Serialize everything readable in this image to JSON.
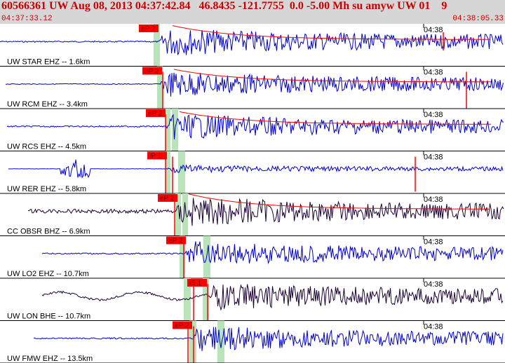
{
  "header": {
    "title": "60566361 UW Aug 08, 2013 04:37:42.84   46.8435 -121.7755  0.0 -5.00 Mh su amyw UW 01    9",
    "start_time": "04:37:33.12",
    "end_time": "04:38:05.33"
  },
  "colors": {
    "header_bg": "#d6d6d6",
    "header_text": "#cc0000",
    "trace_blue": "#0000cc",
    "trace_dark": "#1a0033",
    "pick_red": "#ff0000",
    "window_green": "#b9e3b9"
  },
  "traces": [
    {
      "label": "UW STAR EHZ -- 1.6km",
      "pick": "eP 2",
      "time_mark": "04:38"
    },
    {
      "label": "UW RCM EHZ -- 3.4km",
      "pick": "eP 2",
      "time_mark": "04:38"
    },
    {
      "label": "UW RCS EHZ -- 4.5km",
      "pick": "eP 2",
      "time_mark": "04:38"
    },
    {
      "label": "UW RER EHZ -- 5.8km",
      "pick": "iP 1",
      "time_mark": "04:38"
    },
    {
      "label": "CC OBSR BHZ -- 6.9km",
      "pick": "eP 2",
      "time_mark": "04:38"
    },
    {
      "label": "UW LO2 EHZ -- 10.7km",
      "pick": "eP 2",
      "time_mark": "04:38"
    },
    {
      "label": "UW LON BHE -- 10.7km",
      "pick": "iS 1",
      "time_mark": "04:38"
    },
    {
      "label": "UW FMW EHZ -- 13.5km",
      "pick": "eP 2",
      "time_mark": "04:38"
    }
  ]
}
